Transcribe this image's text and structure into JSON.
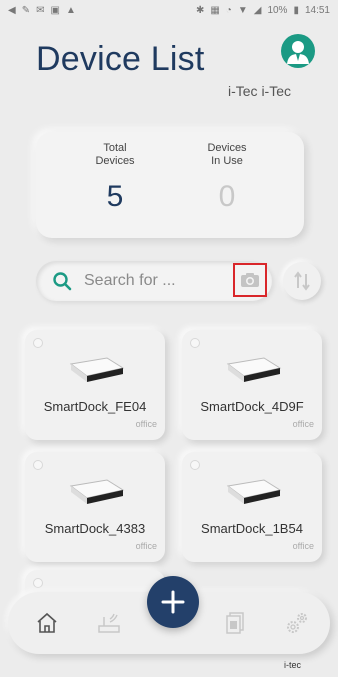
{
  "status_bar": {
    "battery": "10%",
    "time": "14:51"
  },
  "header": {
    "title": "Device List",
    "username": "i-Tec i-Tec"
  },
  "stats": {
    "total_label": "Total\nDevices",
    "total_value": "5",
    "in_use_label": "Devices\nIn Use",
    "in_use_value": "0"
  },
  "search": {
    "placeholder": "Search for ..."
  },
  "devices": [
    {
      "name": "SmartDock_FE04",
      "location": "office"
    },
    {
      "name": "SmartDock_4D9F",
      "location": "office"
    },
    {
      "name": "SmartDock_4383",
      "location": "office"
    },
    {
      "name": "SmartDock_1B54",
      "location": "office"
    }
  ],
  "footer": {
    "brand": "i-tec"
  },
  "colors": {
    "primary": "#1f3a5f",
    "avatar": "#1b9a84",
    "highlight": "#d9262a",
    "background": "#ececec"
  }
}
